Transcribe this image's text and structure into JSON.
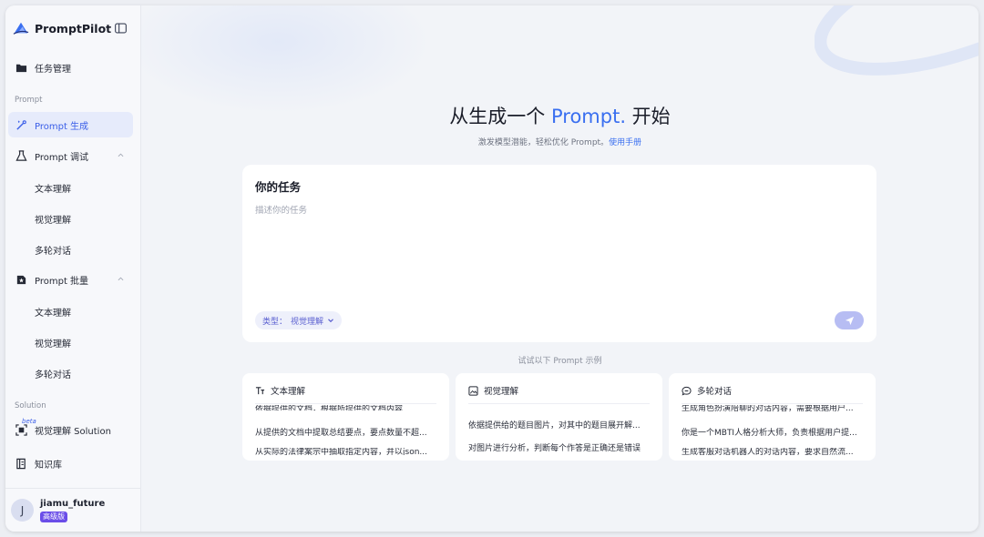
{
  "sidebar": {
    "brand": "PromptPilot",
    "task_mgmt": "任务管理",
    "section_prompt": "Prompt",
    "gen": "Prompt 生成",
    "debug": "Prompt 调试",
    "debug_items": [
      "文本理解",
      "视觉理解",
      "多轮对话"
    ],
    "batch": "Prompt 批量",
    "batch_items": [
      "文本理解",
      "视觉理解",
      "多轮对话"
    ],
    "section_solution": "Solution",
    "beta": "beta",
    "vision_solution": "视觉理解 Solution",
    "kb": "知识库"
  },
  "user": {
    "initial": "J",
    "name": "jiamu_future",
    "plan": "高级版"
  },
  "hero": {
    "title_pre": "从生成一个 ",
    "title_accent": "Prompt.",
    "title_post": " 开始",
    "sub": "激发模型潜能，轻松优化 Prompt。",
    "manual": "使用手册"
  },
  "task": {
    "title": "你的任务",
    "placeholder": "描述你的任务",
    "type_label": "类型：",
    "type_value": "视觉理解"
  },
  "examples": {
    "label": "试试以下 Prompt 示例",
    "cards": [
      {
        "title": "文本理解",
        "icon": "text-type-icon",
        "top": "依据提供的文档，根据所提供的文档内容",
        "lines": [
          "从提供的文档中提取总结要点，要点数量不超...",
          "从实际的法律案宗中抽取指定内容，并以json..."
        ]
      },
      {
        "title": "视觉理解",
        "icon": "image-icon",
        "top": "",
        "lines": [
          "依据提供给的题目图片，对其中的题目展开解...",
          "对图片进行分析，判断每个作答是正确还是错误"
        ]
      },
      {
        "title": "多轮对话",
        "icon": "chat-icon",
        "top": "生成角色扮演陪聊的对话内容，需要根据用户...",
        "lines": [
          "你是一个MBTI人格分析大师，负责根据用户提...",
          "生成客服对话机器人的对话内容，要求自然流..."
        ]
      }
    ]
  },
  "colors": {
    "accent": "#3a6ff0",
    "active_bg": "#e6ebfb",
    "badge": "#6a4de8"
  }
}
